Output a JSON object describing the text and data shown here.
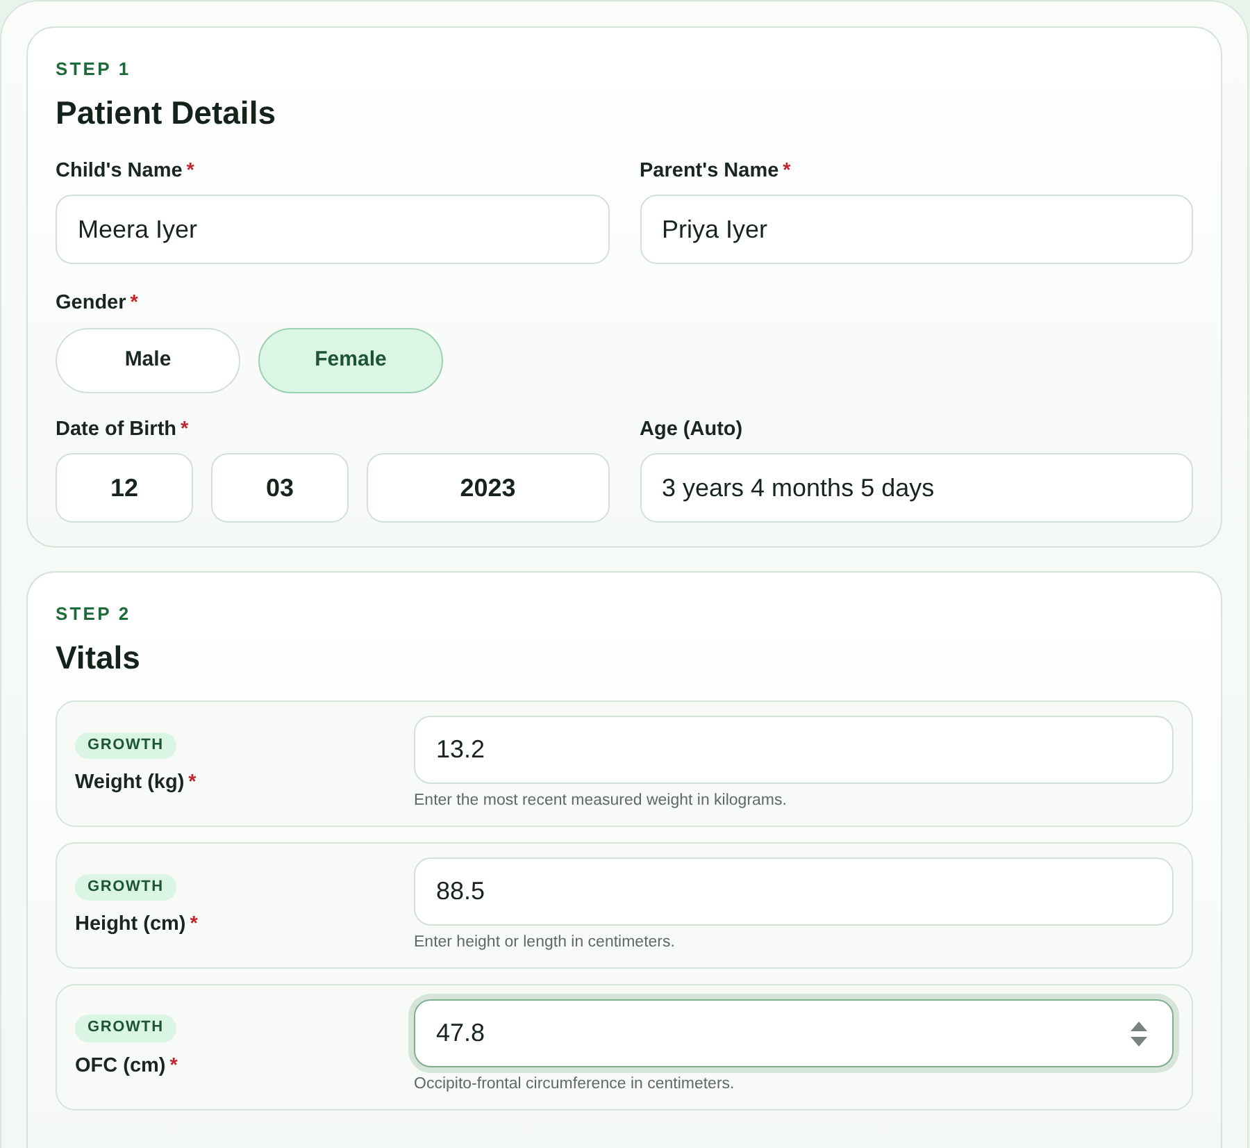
{
  "patient_details": {
    "step_label": "STEP 1",
    "title": "Patient Details",
    "childs_name": {
      "label": "Child's Name",
      "required_mark": "*",
      "value": "Meera Iyer"
    },
    "parents_name": {
      "label": "Parent's Name",
      "required_mark": "*",
      "value": "Priya Iyer"
    },
    "gender": {
      "label": "Gender",
      "required_mark": "*",
      "options": [
        {
          "label": "Male",
          "selected": false
        },
        {
          "label": "Female",
          "selected": true
        }
      ]
    },
    "date_of_birth": {
      "label": "Date of Birth",
      "required_mark": "*",
      "day": "12",
      "month": "03",
      "year": "2023"
    },
    "age": {
      "label": "Age (Auto)",
      "value": "3 years 4 months 5 days"
    }
  },
  "vitals": {
    "step_label": "STEP 2",
    "title": "Vitals",
    "items": [
      {
        "tag": "GROWTH",
        "label": "Weight (kg)",
        "required_mark": "*",
        "value": "13.2",
        "help": "Enter the most recent measured weight in kilograms.",
        "focused": false
      },
      {
        "tag": "GROWTH",
        "label": "Height (cm)",
        "required_mark": "*",
        "value": "88.5",
        "help": "Enter height or length in centimeters.",
        "focused": false
      },
      {
        "tag": "GROWTH",
        "label": "OFC (cm)",
        "required_mark": "*",
        "value": "47.8",
        "help": "Occipito-frontal circumference in centimeters.",
        "focused": true
      }
    ]
  }
}
